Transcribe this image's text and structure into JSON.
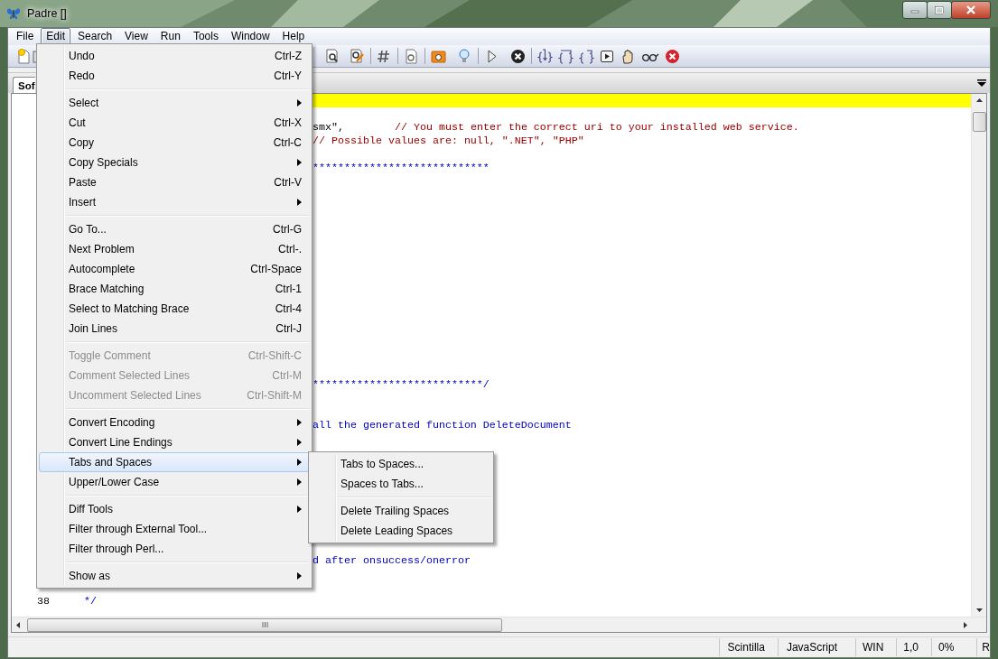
{
  "window": {
    "title": "Padre []"
  },
  "menu_bar": [
    {
      "label": "File",
      "selected": false
    },
    {
      "label": "Edit",
      "selected": true
    },
    {
      "label": "Search",
      "selected": false
    },
    {
      "label": "View",
      "selected": false
    },
    {
      "label": "Run",
      "selected": false
    },
    {
      "label": "Tools",
      "selected": false
    },
    {
      "label": "Window",
      "selected": false
    },
    {
      "label": "Help",
      "selected": false
    }
  ],
  "tabs": [
    {
      "label": "Sof",
      "selected": true
    }
  ],
  "editor": {
    "lines": [
      {
        "segments": [
          {
            "kind": "plain",
            "text": "smx\","
          },
          {
            "kind": "line-comment",
            "text": "// You must enter the correct uri to your installed web service."
          }
        ]
      },
      {
        "segments": [
          {
            "kind": "line-comment",
            "text": "// Possible values are: null, \".NET\", \"PHP\""
          }
        ]
      },
      {
        "segments": [
          {
            "kind": "block-comment",
            "text": "****************************"
          }
        ]
      },
      {
        "segments": [
          {
            "kind": "block-comment",
            "text": "***************************/"
          }
        ]
      },
      {
        "segments": [
          {
            "kind": "block-comment",
            "text": "all the generated function DeleteDocument"
          }
        ]
      },
      {
        "segments": [
          {
            "kind": "block-comment",
            "text": "d after onsuccess/onerror"
          }
        ]
      },
      {
        "number": "38",
        "segments": [
          {
            "kind": "block-comment",
            "text": "*/"
          }
        ]
      }
    ]
  },
  "edit_menu": {
    "groups": [
      [
        {
          "label": "Undo",
          "shortcut": "Ctrl-Z",
          "submenu": false,
          "disabled": false,
          "selected": false
        },
        {
          "label": "Redo",
          "shortcut": "Ctrl-Y",
          "submenu": false,
          "disabled": false,
          "selected": false
        }
      ],
      [
        {
          "label": "Select",
          "submenu": true,
          "disabled": false,
          "selected": false
        },
        {
          "label": "Cut",
          "shortcut": "Ctrl-X",
          "submenu": false,
          "disabled": false,
          "selected": false
        },
        {
          "label": "Copy",
          "shortcut": "Ctrl-C",
          "submenu": false,
          "disabled": false,
          "selected": false
        },
        {
          "label": "Copy Specials",
          "submenu": true,
          "disabled": false,
          "selected": false
        },
        {
          "label": "Paste",
          "shortcut": "Ctrl-V",
          "submenu": false,
          "disabled": false,
          "selected": false
        },
        {
          "label": "Insert",
          "submenu": true,
          "disabled": false,
          "selected": false
        }
      ],
      [
        {
          "label": "Go To...",
          "shortcut": "Ctrl-G",
          "submenu": false,
          "disabled": false,
          "selected": false
        },
        {
          "label": "Next Problem",
          "shortcut": "Ctrl-.",
          "submenu": false,
          "disabled": false,
          "selected": false
        },
        {
          "label": "Autocomplete",
          "shortcut": "Ctrl-Space",
          "submenu": false,
          "disabled": false,
          "selected": false
        },
        {
          "label": "Brace Matching",
          "shortcut": "Ctrl-1",
          "submenu": false,
          "disabled": false,
          "selected": false
        },
        {
          "label": "Select to Matching Brace",
          "shortcut": "Ctrl-4",
          "submenu": false,
          "disabled": false,
          "selected": false
        },
        {
          "label": "Join Lines",
          "shortcut": "Ctrl-J",
          "submenu": false,
          "disabled": false,
          "selected": false
        }
      ],
      [
        {
          "label": "Toggle Comment",
          "shortcut": "Ctrl-Shift-C",
          "submenu": false,
          "disabled": true,
          "selected": false
        },
        {
          "label": "Comment Selected Lines",
          "shortcut": "Ctrl-M",
          "submenu": false,
          "disabled": true,
          "selected": false
        },
        {
          "label": "Uncomment Selected Lines",
          "shortcut": "Ctrl-Shift-M",
          "submenu": false,
          "disabled": true,
          "selected": false
        }
      ],
      [
        {
          "label": "Convert Encoding",
          "submenu": true,
          "disabled": false,
          "selected": false
        },
        {
          "label": "Convert Line Endings",
          "submenu": true,
          "disabled": false,
          "selected": false
        },
        {
          "label": "Tabs and Spaces",
          "submenu": true,
          "disabled": false,
          "selected": true
        },
        {
          "label": "Upper/Lower Case",
          "submenu": true,
          "disabled": false,
          "selected": false
        }
      ],
      [
        {
          "label": "Diff Tools",
          "submenu": true,
          "disabled": false,
          "selected": false
        },
        {
          "label": "Filter through External Tool...",
          "submenu": false,
          "disabled": false,
          "selected": false
        },
        {
          "label": "Filter through Perl...",
          "submenu": false,
          "disabled": false,
          "selected": false
        }
      ],
      [
        {
          "label": "Show as",
          "submenu": true,
          "disabled": false,
          "selected": false
        }
      ]
    ]
  },
  "tabs_spaces_menu": {
    "groups": [
      [
        {
          "label": "Tabs to Spaces...",
          "submenu": false,
          "disabled": false,
          "selected": false
        },
        {
          "label": "Spaces to Tabs...",
          "submenu": false,
          "disabled": false,
          "selected": false
        }
      ],
      [
        {
          "label": "Delete Trailing Spaces",
          "submenu": false,
          "disabled": false,
          "selected": false
        },
        {
          "label": "Delete Leading Spaces",
          "submenu": false,
          "disabled": false,
          "selected": false
        }
      ]
    ]
  },
  "status_bar": [
    "Scintilla",
    "JavaScript",
    "WIN",
    "1,0",
    "0%",
    "R"
  ]
}
